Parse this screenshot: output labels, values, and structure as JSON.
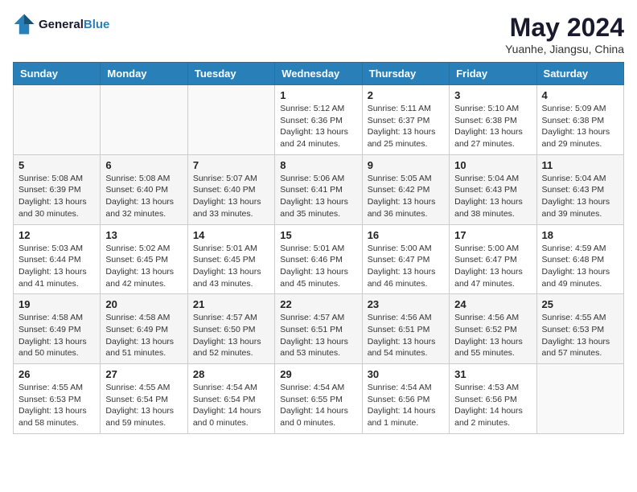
{
  "header": {
    "logo_line1": "General",
    "logo_line2": "Blue",
    "month": "May 2024",
    "location": "Yuanhe, Jiangsu, China"
  },
  "weekdays": [
    "Sunday",
    "Monday",
    "Tuesday",
    "Wednesday",
    "Thursday",
    "Friday",
    "Saturday"
  ],
  "weeks": [
    [
      {
        "day": "",
        "info": ""
      },
      {
        "day": "",
        "info": ""
      },
      {
        "day": "",
        "info": ""
      },
      {
        "day": "1",
        "info": "Sunrise: 5:12 AM\nSunset: 6:36 PM\nDaylight: 13 hours\nand 24 minutes."
      },
      {
        "day": "2",
        "info": "Sunrise: 5:11 AM\nSunset: 6:37 PM\nDaylight: 13 hours\nand 25 minutes."
      },
      {
        "day": "3",
        "info": "Sunrise: 5:10 AM\nSunset: 6:38 PM\nDaylight: 13 hours\nand 27 minutes."
      },
      {
        "day": "4",
        "info": "Sunrise: 5:09 AM\nSunset: 6:38 PM\nDaylight: 13 hours\nand 29 minutes."
      }
    ],
    [
      {
        "day": "5",
        "info": "Sunrise: 5:08 AM\nSunset: 6:39 PM\nDaylight: 13 hours\nand 30 minutes."
      },
      {
        "day": "6",
        "info": "Sunrise: 5:08 AM\nSunset: 6:40 PM\nDaylight: 13 hours\nand 32 minutes."
      },
      {
        "day": "7",
        "info": "Sunrise: 5:07 AM\nSunset: 6:40 PM\nDaylight: 13 hours\nand 33 minutes."
      },
      {
        "day": "8",
        "info": "Sunrise: 5:06 AM\nSunset: 6:41 PM\nDaylight: 13 hours\nand 35 minutes."
      },
      {
        "day": "9",
        "info": "Sunrise: 5:05 AM\nSunset: 6:42 PM\nDaylight: 13 hours\nand 36 minutes."
      },
      {
        "day": "10",
        "info": "Sunrise: 5:04 AM\nSunset: 6:43 PM\nDaylight: 13 hours\nand 38 minutes."
      },
      {
        "day": "11",
        "info": "Sunrise: 5:04 AM\nSunset: 6:43 PM\nDaylight: 13 hours\nand 39 minutes."
      }
    ],
    [
      {
        "day": "12",
        "info": "Sunrise: 5:03 AM\nSunset: 6:44 PM\nDaylight: 13 hours\nand 41 minutes."
      },
      {
        "day": "13",
        "info": "Sunrise: 5:02 AM\nSunset: 6:45 PM\nDaylight: 13 hours\nand 42 minutes."
      },
      {
        "day": "14",
        "info": "Sunrise: 5:01 AM\nSunset: 6:45 PM\nDaylight: 13 hours\nand 43 minutes."
      },
      {
        "day": "15",
        "info": "Sunrise: 5:01 AM\nSunset: 6:46 PM\nDaylight: 13 hours\nand 45 minutes."
      },
      {
        "day": "16",
        "info": "Sunrise: 5:00 AM\nSunset: 6:47 PM\nDaylight: 13 hours\nand 46 minutes."
      },
      {
        "day": "17",
        "info": "Sunrise: 5:00 AM\nSunset: 6:47 PM\nDaylight: 13 hours\nand 47 minutes."
      },
      {
        "day": "18",
        "info": "Sunrise: 4:59 AM\nSunset: 6:48 PM\nDaylight: 13 hours\nand 49 minutes."
      }
    ],
    [
      {
        "day": "19",
        "info": "Sunrise: 4:58 AM\nSunset: 6:49 PM\nDaylight: 13 hours\nand 50 minutes."
      },
      {
        "day": "20",
        "info": "Sunrise: 4:58 AM\nSunset: 6:49 PM\nDaylight: 13 hours\nand 51 minutes."
      },
      {
        "day": "21",
        "info": "Sunrise: 4:57 AM\nSunset: 6:50 PM\nDaylight: 13 hours\nand 52 minutes."
      },
      {
        "day": "22",
        "info": "Sunrise: 4:57 AM\nSunset: 6:51 PM\nDaylight: 13 hours\nand 53 minutes."
      },
      {
        "day": "23",
        "info": "Sunrise: 4:56 AM\nSunset: 6:51 PM\nDaylight: 13 hours\nand 54 minutes."
      },
      {
        "day": "24",
        "info": "Sunrise: 4:56 AM\nSunset: 6:52 PM\nDaylight: 13 hours\nand 55 minutes."
      },
      {
        "day": "25",
        "info": "Sunrise: 4:55 AM\nSunset: 6:53 PM\nDaylight: 13 hours\nand 57 minutes."
      }
    ],
    [
      {
        "day": "26",
        "info": "Sunrise: 4:55 AM\nSunset: 6:53 PM\nDaylight: 13 hours\nand 58 minutes."
      },
      {
        "day": "27",
        "info": "Sunrise: 4:55 AM\nSunset: 6:54 PM\nDaylight: 13 hours\nand 59 minutes."
      },
      {
        "day": "28",
        "info": "Sunrise: 4:54 AM\nSunset: 6:54 PM\nDaylight: 14 hours\nand 0 minutes."
      },
      {
        "day": "29",
        "info": "Sunrise: 4:54 AM\nSunset: 6:55 PM\nDaylight: 14 hours\nand 0 minutes."
      },
      {
        "day": "30",
        "info": "Sunrise: 4:54 AM\nSunset: 6:56 PM\nDaylight: 14 hours\nand 1 minute."
      },
      {
        "day": "31",
        "info": "Sunrise: 4:53 AM\nSunset: 6:56 PM\nDaylight: 14 hours\nand 2 minutes."
      },
      {
        "day": "",
        "info": ""
      }
    ]
  ]
}
